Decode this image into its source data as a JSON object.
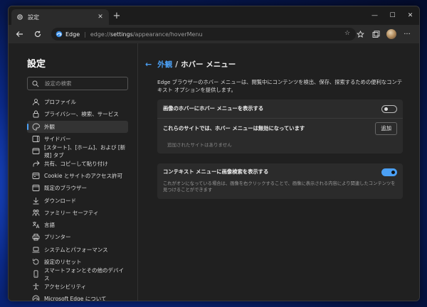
{
  "tab": {
    "title": "設定",
    "close": "✕"
  },
  "newtab": "+",
  "window_controls": {
    "minimize": "—",
    "maximize": "☐",
    "close": "✕"
  },
  "address": {
    "brand": "Edge",
    "separator": "|",
    "url_prefix": "edge://",
    "url_bold": "settings",
    "url_suffix": "/appearance/hoverMenu"
  },
  "sidebar": {
    "title": "設定",
    "search_placeholder": "設定の検索",
    "items": [
      {
        "label": "プロファイル",
        "icon": "profile-icon"
      },
      {
        "label": "プライバシー、検索、サービス",
        "icon": "lock-icon"
      },
      {
        "label": "外観",
        "icon": "palette-icon",
        "active": true
      },
      {
        "label": "サイドバー",
        "icon": "sidebar-icon"
      },
      {
        "label": "[スタート]、[ホーム]、および [新規] タブ",
        "icon": "tabs-icon"
      },
      {
        "label": "共有、コピーして貼り付け",
        "icon": "share-icon"
      },
      {
        "label": "Cookie とサイトのアクセス許可",
        "icon": "cookie-icon"
      },
      {
        "label": "既定のブラウザー",
        "icon": "browser-icon"
      },
      {
        "label": "ダウンロード",
        "icon": "download-icon"
      },
      {
        "label": "ファミリー セーフティ",
        "icon": "family-icon"
      },
      {
        "label": "言語",
        "icon": "language-icon"
      },
      {
        "label": "プリンター",
        "icon": "printer-icon"
      },
      {
        "label": "システムとパフォーマンス",
        "icon": "laptop-icon"
      },
      {
        "label": "設定のリセット",
        "icon": "reset-icon"
      },
      {
        "label": "スマートフォンとその他のデバイス",
        "icon": "phone-icon"
      },
      {
        "label": "アクセシビリティ",
        "icon": "accessibility-icon"
      },
      {
        "label": "Microsoft Edge について",
        "icon": "edge-icon"
      }
    ]
  },
  "main": {
    "back": "←",
    "crumb_parent": "外観",
    "crumb_sep": "/",
    "crumb_current": "ホバー メニュー",
    "description": "Edge ブラウザーのホバー メニューは、閲覧中にコンテンツを検出、保存、探索するための便利なコンテキスト オプションを提供します。",
    "card1": {
      "show_hover_label": "画像のホバーにホバー メニューを表示する",
      "show_hover_on": false,
      "disabled_sites_label": "これらのサイトでは、ホバー メニューは無効になっています",
      "add_button": "追加",
      "empty_text": "追加されたサイトはありません"
    },
    "card2": {
      "visual_search_label": "コンテキスト メニューに画像検索を表示する",
      "visual_search_on": true,
      "visual_search_desc": "これがオンになっている場合は、画像を右クリックすることで、画像に表示される内容により関連したコンテンツを見つけることができます"
    }
  },
  "colors": {
    "accent": "#4ba0f5",
    "background": "#202020",
    "card": "#2b2b2b"
  }
}
